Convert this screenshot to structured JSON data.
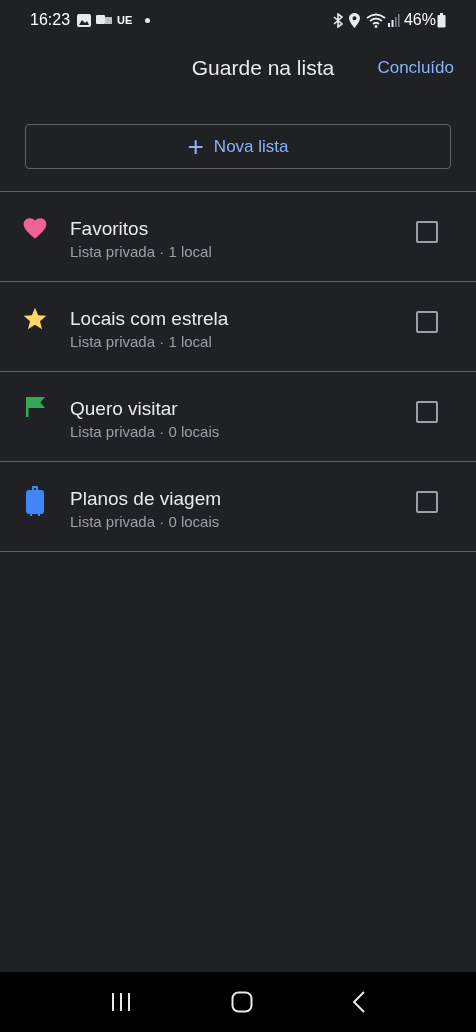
{
  "status_bar": {
    "time": "16:23",
    "carrier": "UE",
    "battery": "46%"
  },
  "header": {
    "title": "Guarde na lista",
    "done": "Concluído"
  },
  "new_list_button": {
    "icon": "+",
    "label": "Nova lista"
  },
  "lists": [
    {
      "kind": "heart",
      "color": "#f06292",
      "name": "Favoritos",
      "subtitle": "Lista privada · 1 local",
      "checked": false
    },
    {
      "kind": "star",
      "color": "#fdd663",
      "name": "Locais com estrela",
      "subtitle": "Lista privada · 1 local",
      "checked": false
    },
    {
      "kind": "flag",
      "color": "#34a853",
      "name": "Quero visitar",
      "subtitle": "Lista privada · 0 locais",
      "checked": false
    },
    {
      "kind": "suitcase",
      "color": "#4285f4",
      "name": "Planos de viagem",
      "subtitle": "Lista privada · 0 locais",
      "checked": false
    }
  ]
}
